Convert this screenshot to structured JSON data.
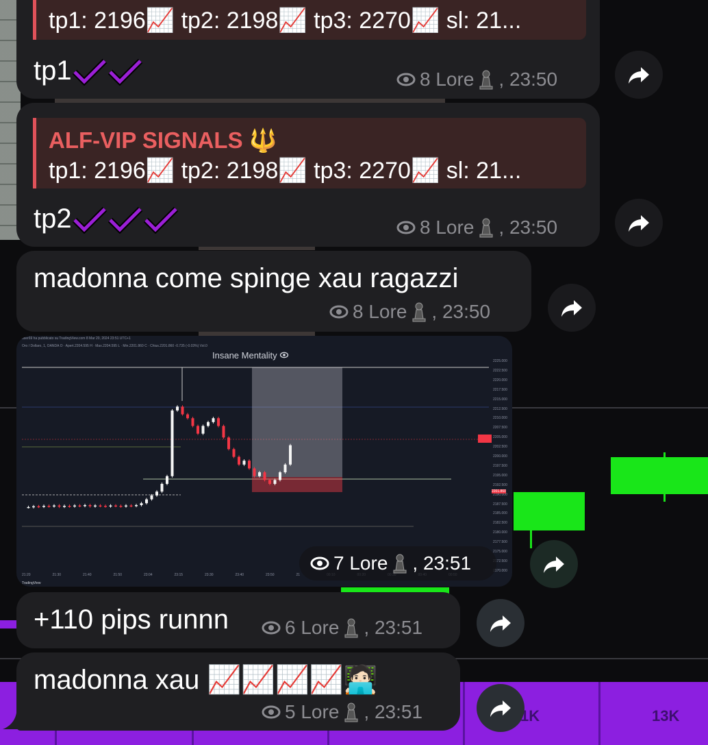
{
  "colors": {
    "bubble": "#1f1f22",
    "reply_bar": "#e0525a",
    "reply_title": "#ea5f60",
    "meta": "#8d8d92",
    "check": "#9b1fd6"
  },
  "messages": [
    {
      "reply": {
        "title": "",
        "line": "tp1: 2196📈 tp2: 2198📈 tp3: 2270📈 sl: 21..."
      },
      "text": "tp1",
      "checks": 2,
      "views": "8 Lore",
      "time": ", 23:50"
    },
    {
      "reply": {
        "title": "ALF-VIP SIGNALS 🔱",
        "line": "tp1: 2196📈 tp2: 2198📈 tp3: 2270📈 sl: 21..."
      },
      "text": "tp2",
      "checks": 3,
      "views": "8 Lore",
      "time": ", 23:50"
    },
    {
      "text": "madonna come spinge xau ragazzi",
      "views": "8 Lore",
      "time": ", 23:50"
    },
    {
      "image": {
        "title": "Insane Mentality",
        "header": "user69 ha pubblicato su TradingView.com 8 Mar 20, 2024 23:51 UTC+1",
        "header2": "Oro / Dollaro, 1, OANDA  O · Apert.2204.595  H · Max.2204.595  L · Min.2201.860  C · Chius.2201.860  -0.735 (-0.03%)  Vol.0",
        "logo": "TradingView"
      },
      "views": "7 Lore",
      "time": ", 23:51"
    },
    {
      "text": "+110 pips runnn",
      "views": "6 Lore",
      "time": ", 23:51"
    },
    {
      "text": "madonna xau 📈📈📈📈🧑🏻‍💻",
      "views": "5 Lore",
      "time": ", 23:51"
    }
  ],
  "background": {
    "labels": [
      "1K",
      "13K"
    ]
  },
  "chart_data": {
    "type": "candlestick",
    "title": "Insane Mentality",
    "ylim": [
      2170,
      2225
    ],
    "y_ticks": [
      "2225.000",
      "2222.500",
      "2220.000",
      "2217.500",
      "2215.000",
      "2212.500",
      "2210.000",
      "2207.500",
      "2205.000",
      "2202.500",
      "2200.000",
      "2197.500",
      "2195.000",
      "2192.500",
      "2190.000",
      "2187.500",
      "2185.000",
      "2182.500",
      "2180.000",
      "2177.500",
      "2175.000",
      "2172.500",
      "2170.000"
    ],
    "x_ticks": [
      "21:20",
      "21:30",
      "21:40",
      "21:50",
      "23:04",
      "23:15",
      "23:30",
      "23:40",
      "23:50",
      "21",
      "00:10",
      "00:20",
      "00:30",
      "00:40",
      "00:50"
    ],
    "current_price": "2201.860",
    "close": [
      2186,
      2186,
      2186.2,
      2186.1,
      2186.3,
      2186.2,
      2186.4,
      2186.1,
      2186.3,
      2186.2,
      2186.4,
      2186.3,
      2186.5,
      2186.2,
      2186.4,
      2186.3,
      2186.2,
      2186.4,
      2186.3,
      2186.2,
      2186.4,
      2186.3,
      2186.5,
      2187,
      2188,
      2189,
      2190,
      2192,
      2194,
      2211,
      2212,
      2210,
      2209,
      2207,
      2205,
      2207,
      2208,
      2209,
      2207,
      2204,
      2201,
      2199,
      2197,
      2198,
      2196,
      2194,
      2195,
      2193,
      2192,
      2193,
      2195,
      2197,
      2202
    ]
  }
}
